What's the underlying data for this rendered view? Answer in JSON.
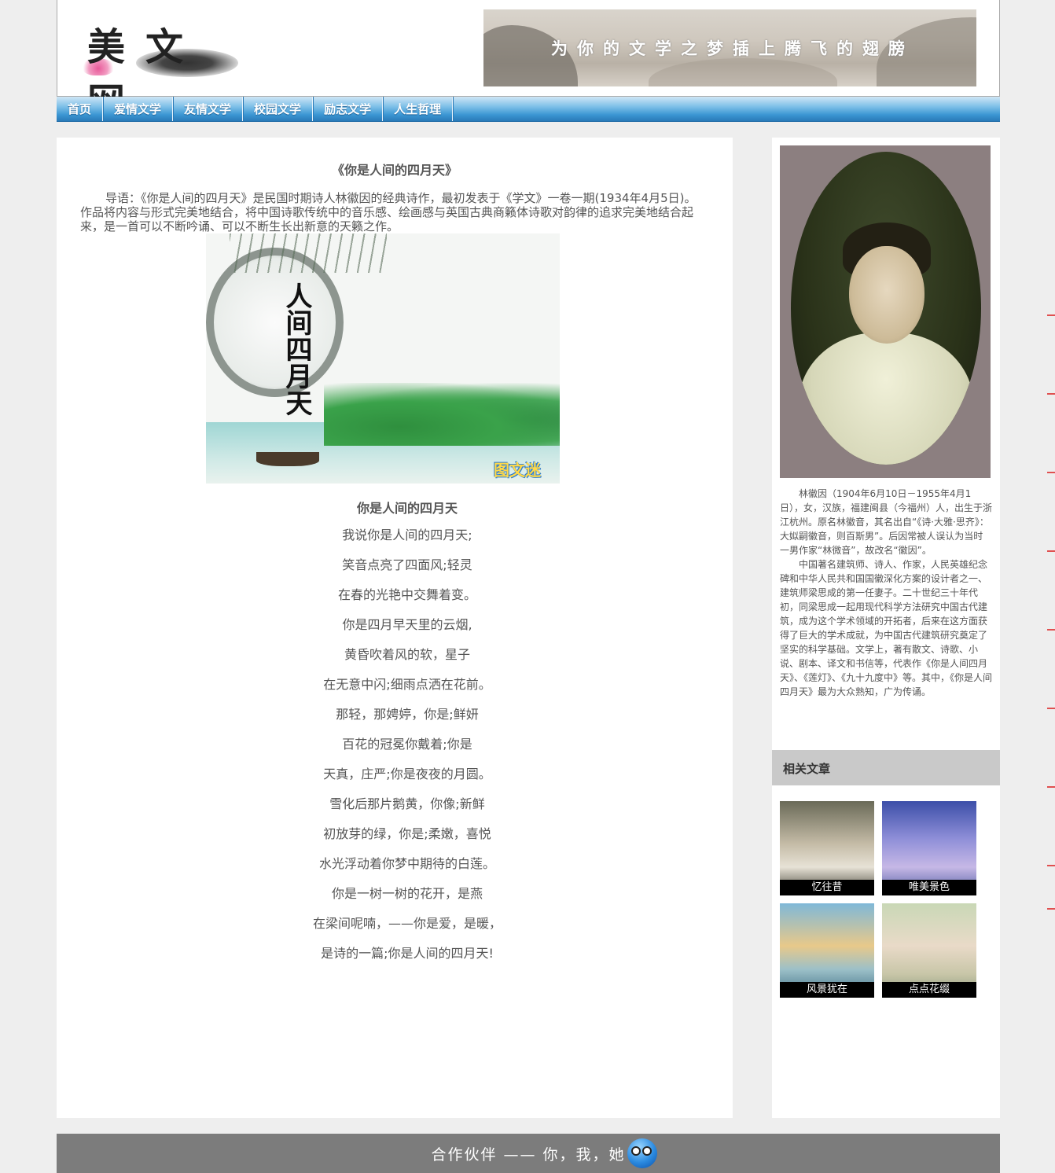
{
  "header": {
    "logo_text": "美文网",
    "banner_slogan": "为你的文学之梦插上腾飞的翅膀"
  },
  "nav": {
    "items": [
      {
        "label": "首页"
      },
      {
        "label": "爱情文学"
      },
      {
        "label": "友情文学"
      },
      {
        "label": "校园文学"
      },
      {
        "label": "励志文学"
      },
      {
        "label": "人生哲理"
      }
    ]
  },
  "article": {
    "title": "《你是人间的四月天》",
    "intro": "导语：《你是人间的四月天》是民国时期诗人林徽因的经典诗作，最初发表于《学文》一卷一期(1934年4月5日)。作品将内容与形式完美地结合，将中国诗歌传统中的音乐感、绘画感与英国古典商籁体诗歌对韵律的追求完美地结合起来，是一首可以不断吟诵、可以不断生长出新意的天籁之作。",
    "image": {
      "calligraphy": "人间四月天",
      "watermark": "图文迷"
    },
    "poem_title": "你是人间的四月天",
    "poem_lines": [
      "我说你是人间的四月天;",
      "笑音点亮了四面风;轻灵",
      "在春的光艳中交舞着变。",
      "你是四月早天里的云烟,",
      "黄昏吹着风的软，星子",
      "在无意中闪;细雨点洒在花前。",
      "那轻，那娉婷，你是;鲜妍",
      "百花的冠冕你戴着;你是",
      "天真，庄严;你是夜夜的月圆。",
      "雪化后那片鹅黄，你像;新鲜",
      "初放芽的绿，你是;柔嫩，喜悦",
      "水光浮动着你梦中期待的白莲。",
      "你是一树一树的花开，是燕",
      "在梁间呢喃，——你是爱，是暖，",
      "是诗的一篇;你是人间的四月天!"
    ]
  },
  "sidebar": {
    "bio_paragraphs": [
      "林徽因（1904年6月10日－1955年4月1日），女，汉族，福建闽县（今福州）人，出生于浙江杭州。原名林徽音，其名出自“《诗·大雅·思齐》：大姒嗣徽音，则百斯男”。后因常被人误认为当时一男作家“林微音”，故改名“徽因”。",
      "中国著名建筑师、诗人、作家，人民英雄纪念碑和中华人民共和国国徽深化方案的设计者之一、建筑师梁思成的第一任妻子。二十世纪三十年代初，同梁思成一起用现代科学方法研究中国古代建筑，成为这个学术领域的开拓者，后来在这方面获得了巨大的学术成就，为中国古代建筑研究奠定了坚实的科学基础。文学上，著有散文、诗歌、小说、剧本、译文和书信等，代表作《你是人间四月天》、《莲灯》、《九十九度中》等。其中，《你是人间四月天》最为大众熟知，广为传诵。"
    ],
    "related_title": "相关文章",
    "related": [
      {
        "caption": "忆往昔"
      },
      {
        "caption": "唯美景色"
      },
      {
        "caption": "风景犹在"
      },
      {
        "caption": "点点花缀"
      }
    ]
  },
  "footer": {
    "text": "合作伙伴 —— 你，我，她"
  },
  "colors": {
    "nav_blue": "#3a95d2",
    "footer_gray": "#7c7c7c",
    "related_header": "#c9c9c9"
  }
}
